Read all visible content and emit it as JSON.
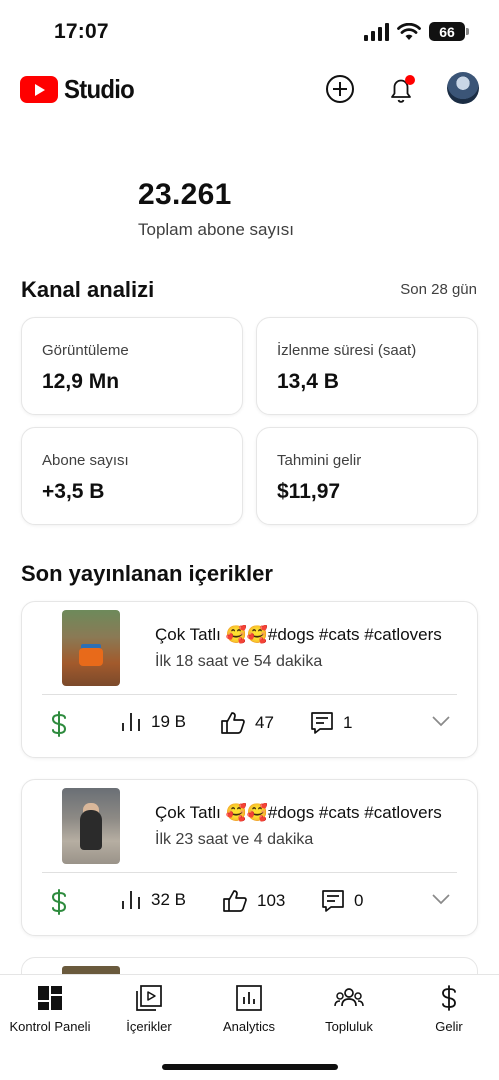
{
  "status_bar": {
    "time": "17:07",
    "battery": "66"
  },
  "header": {
    "logo_text": "Studio",
    "brand_color": "#ff0000",
    "notification_dot_color": "#ff0000",
    "icons": [
      "create-icon",
      "bell-icon",
      "avatar"
    ]
  },
  "subscribers": {
    "count": "23.261",
    "label": "Toplam abone sayısı"
  },
  "analytics": {
    "title": "Kanal analizi",
    "period": "Son 28 gün",
    "cards": [
      {
        "label": "Görüntüleme",
        "value": "12,9 Mn"
      },
      {
        "label": "İzlenme süresi (saat)",
        "value": "13,4 B"
      },
      {
        "label": "Abone sayısı",
        "value": "+3,5 B"
      },
      {
        "label": "Tahmini gelir",
        "value": "$11,97"
      }
    ]
  },
  "recent": {
    "title": "Son yayınlanan içerikler",
    "items": [
      {
        "title": "Çok Tatlı 🥰🥰#dogs #cats #catlovers",
        "subtitle": "İlk 18 saat ve 54 dakika",
        "views": "19 B",
        "likes": "47",
        "comments": "1"
      },
      {
        "title": "Çok Tatlı 🥰🥰#dogs #cats #catlovers",
        "subtitle": "İlk 23 saat ve 4 dakika",
        "views": "32 B",
        "likes": "103",
        "comments": "0"
      }
    ],
    "money_color": "#2e8b3e"
  },
  "bottom_nav": {
    "items": [
      {
        "label": "Kontrol Paneli",
        "icon": "dashboard-icon"
      },
      {
        "label": "İçerikler",
        "icon": "content-icon"
      },
      {
        "label": "Analytics",
        "icon": "analytics-icon"
      },
      {
        "label": "Topluluk",
        "icon": "community-icon"
      },
      {
        "label": "Gelir",
        "icon": "earn-icon"
      }
    ]
  }
}
